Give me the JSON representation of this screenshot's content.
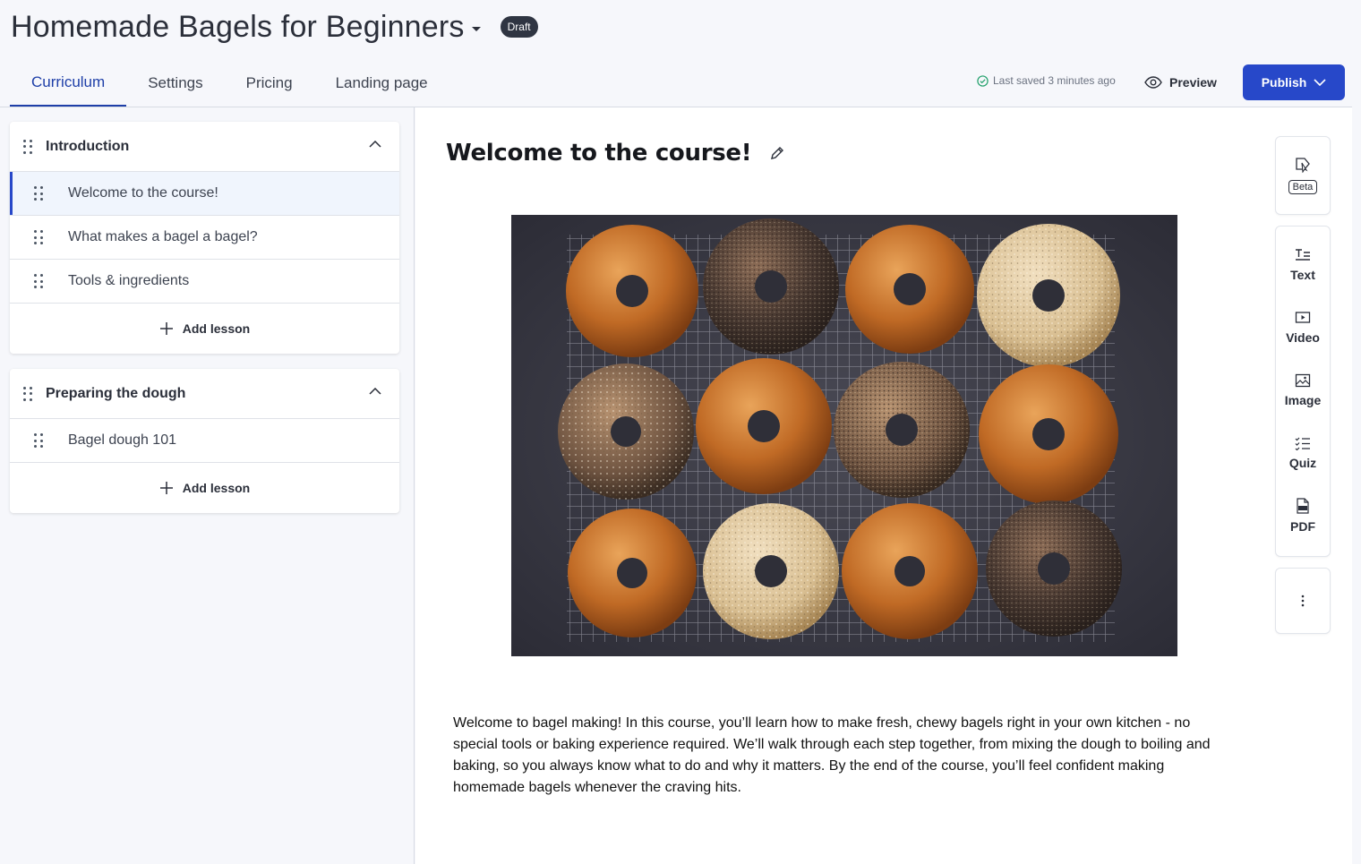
{
  "header": {
    "course_title": "Homemade Bagels for Beginners",
    "status_badge": "Draft",
    "tabs": [
      {
        "label": "Curriculum",
        "active": true
      },
      {
        "label": "Settings",
        "active": false
      },
      {
        "label": "Pricing",
        "active": false
      },
      {
        "label": "Landing page",
        "active": false
      }
    ],
    "saved_status": "Last saved 3 minutes ago",
    "preview_label": "Preview",
    "publish_label": "Publish"
  },
  "curriculum": {
    "sections": [
      {
        "title": "Introduction",
        "lessons": [
          "Welcome to the course!",
          "What makes a bagel a bagel?",
          "Tools & ingredients"
        ],
        "add_label": "Add lesson"
      },
      {
        "title": "Preparing the dough",
        "lessons": [
          "Bagel dough 101"
        ],
        "add_label": "Add lesson"
      }
    ]
  },
  "lesson": {
    "title": "Welcome to the course!",
    "image_icon": "bagels-photo",
    "body": "Welcome to bagel making! In this course, you’ll learn how to make fresh, chewy bagels right in your own kitchen - no special tools or baking experience required. We’ll walk through each step together, from mixing the dough to boiling and baking, so you always know what to do and why it matters. By the end of the course, you’ll feel confident making homemade bagels whenever the craving hits."
  },
  "toolbar": {
    "beta_label": "Beta",
    "tools": [
      {
        "label": "Text",
        "icon": "text-icon"
      },
      {
        "label": "Video",
        "icon": "video-icon"
      },
      {
        "label": "Image",
        "icon": "image-icon"
      },
      {
        "label": "Quiz",
        "icon": "quiz-icon"
      },
      {
        "label": "PDF",
        "icon": "pdf-icon"
      }
    ]
  },
  "colors": {
    "accent": "#2748c9",
    "badge_bg": "#2f3542",
    "saved_check": "#22a06b"
  }
}
